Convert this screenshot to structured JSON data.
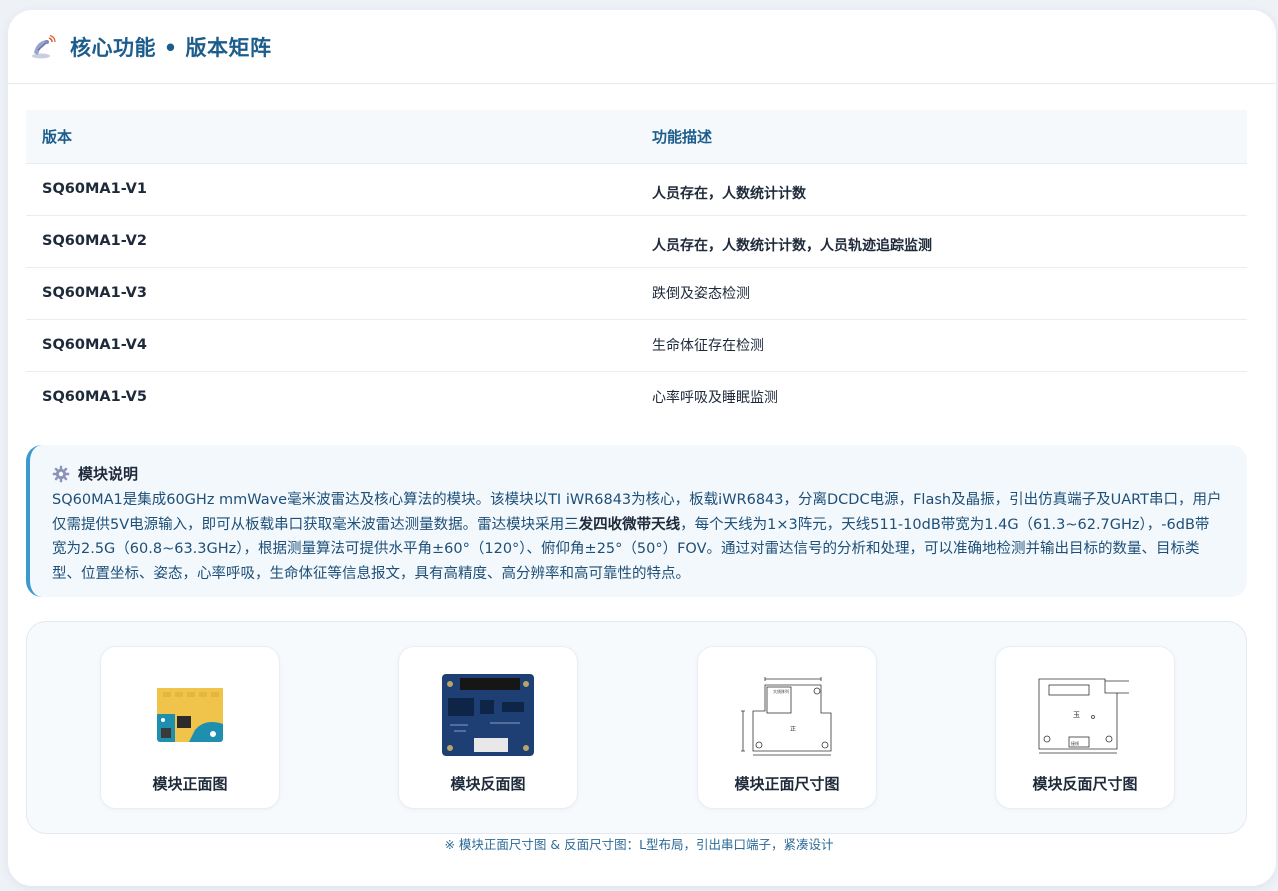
{
  "header": {
    "title": "核心功能 • 版本矩阵",
    "icon": "satellite-dish-icon"
  },
  "table": {
    "columns": [
      "版本",
      "功能描述"
    ],
    "rows": [
      {
        "version": "SQ60MA1-V1",
        "description": "人员存在，人数统计计数"
      },
      {
        "version": "SQ60MA1-V2",
        "description": "人员存在，人数统计计数，人员轨迹追踪监测"
      },
      {
        "version": "SQ60MA1-V3",
        "description": "跌倒及姿态检测"
      },
      {
        "version": "SQ60MA1-V4",
        "description": "生命体征存在检测"
      },
      {
        "version": "SQ60MA1-V5",
        "description": "心率呼吸及睡眠监测"
      }
    ]
  },
  "note": {
    "title": "模块说明",
    "icon": "gear-icon",
    "text_before": "SQ60MA1是集成60GHz mmWave毫米波雷达及核心算法的模块。该模块以TI iWR6843为核心，板载iWR6843，分离DCDC电源，Flash及晶振，引出仿真端子及UART串口，用户仅需提供5V电源输入，即可从板载串口获取毫米波雷达测量数据。雷达模块采用三",
    "text_bold": "发四收微带天线",
    "text_after": "，每个天线为1×3阵元，天线511-10dB带宽为1.4G（61.3~62.7GHz），-6dB带宽为2.5G（60.8~63.3GHz），根据测量算法可提供水平角±60°（120°）、俯仰角±25°（50°）FOV。通过对雷达信号的分析和处理，可以准确地检测并输出目标的数量、目标类型、位置坐标、姿态，心率呼吸，生命体征等信息报文，具有高精度、高分辨率和高可靠性的特点。"
  },
  "gallery": [
    {
      "caption": "模块正面图"
    },
    {
      "caption": "模块反面图"
    },
    {
      "caption": "模块正面尺寸图",
      "drawing_label": "大线阵列",
      "drawing_mark": "正"
    },
    {
      "caption": "模块反面尺寸图",
      "drawing_mark": "玉",
      "drawing_label": "接线"
    }
  ],
  "footnote": "※ 模块正面尺寸图 & 反面尺寸图：L型布局，引出串口端子，紧凑设计",
  "colors": {
    "accent": "#1d5d8c",
    "border_accent": "#3a9ad0",
    "pcb_blue": "#1f5f8f",
    "pcb_gold": "#f0c34a"
  }
}
